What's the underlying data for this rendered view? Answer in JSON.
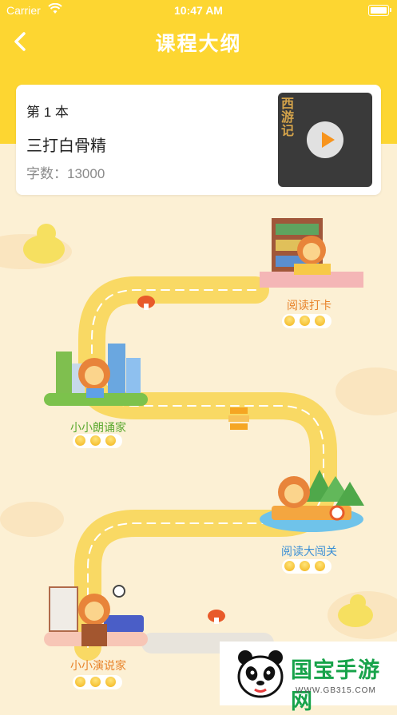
{
  "status_bar": {
    "carrier": "Carrier",
    "time": "10:47 AM"
  },
  "header": {
    "title": "课程大纲"
  },
  "book_card": {
    "book_number": "第 1 本",
    "book_title": "三打白骨精",
    "word_count": "字数：13000",
    "cover_title": "西游记"
  },
  "stages": [
    {
      "label": "阅读打卡",
      "stars": 3
    },
    {
      "label": "小小朗诵家",
      "stars": 3
    },
    {
      "label": "阅读大闯关",
      "stars": 3
    },
    {
      "label": "小小演说家",
      "stars": 3
    }
  ],
  "colors": {
    "accent": "#fdd631",
    "label_orange": "#e8832a",
    "label_green": "#5aa82e",
    "label_blue": "#3a8fd6",
    "path": "#fde27c"
  },
  "watermark": {
    "text": "国宝手游网",
    "url": "WWW.GB315.COM"
  }
}
